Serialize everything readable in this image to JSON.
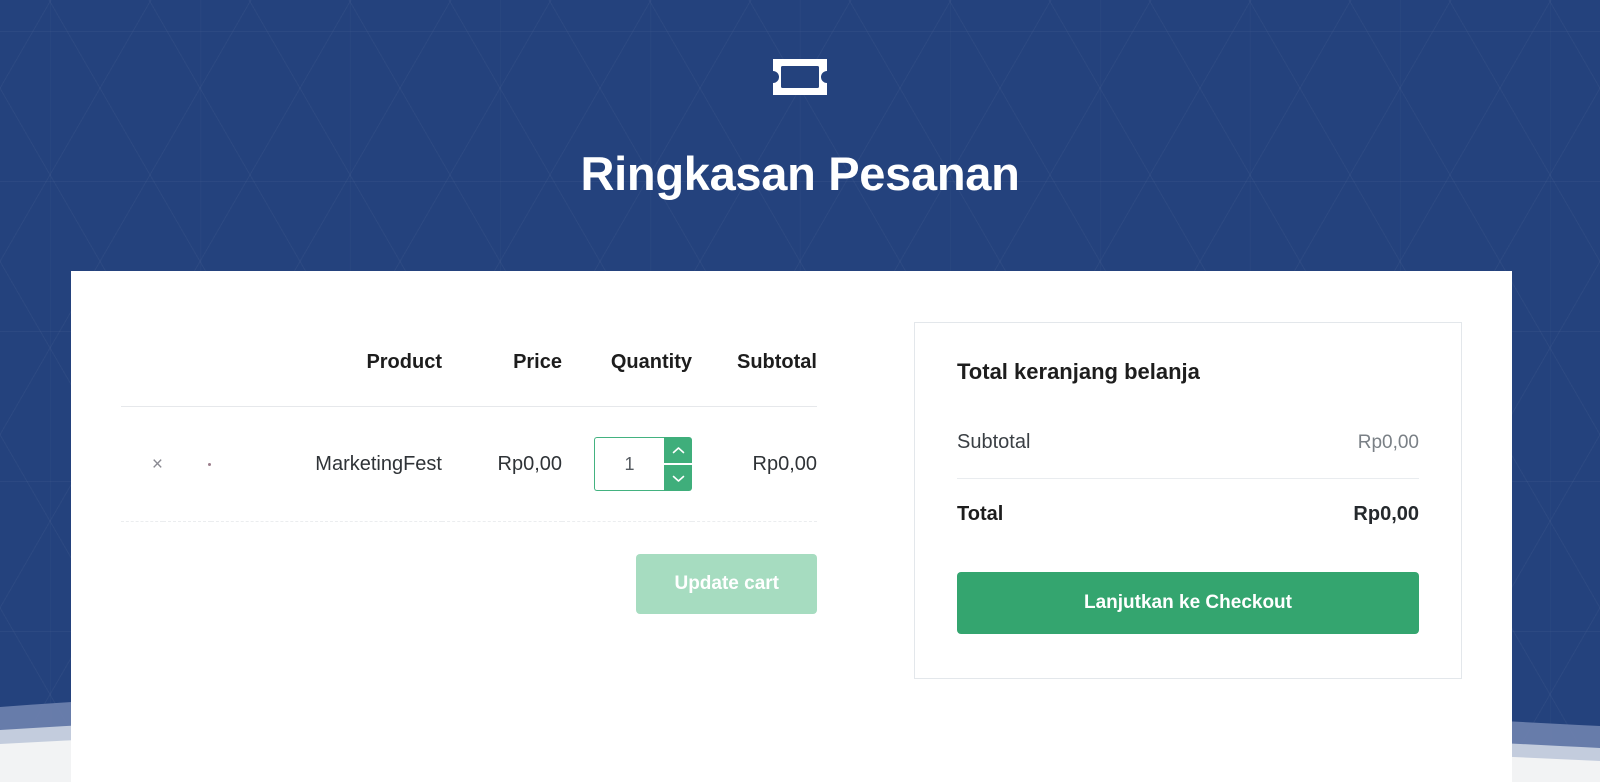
{
  "header": {
    "icon": "ticket-icon",
    "title": "Ringkasan Pesanan"
  },
  "cart_table": {
    "columns": [
      "Product",
      "Price",
      "Quantity",
      "Subtotal"
    ],
    "rows": [
      {
        "remove_label": "×",
        "name": "MarketingFest",
        "price": "Rp0,00",
        "quantity": "1",
        "subtotal": "Rp0,00"
      }
    ]
  },
  "actions": {
    "update_cart_label": "Update cart"
  },
  "totals": {
    "title": "Total keranjang belanja",
    "rows": [
      {
        "label": "Subtotal",
        "value": "Rp0,00"
      },
      {
        "label": "Total",
        "value": "Rp0,00"
      }
    ],
    "checkout_label": "Lanjutkan ke Checkout"
  },
  "colors": {
    "background_navy": "#24427d",
    "accent_green": "#34a56f",
    "stepper_green": "#3fae7b",
    "disabled_green": "#a6dcc0",
    "card_white": "#ffffff",
    "border_gray": "#e3e7eb"
  }
}
